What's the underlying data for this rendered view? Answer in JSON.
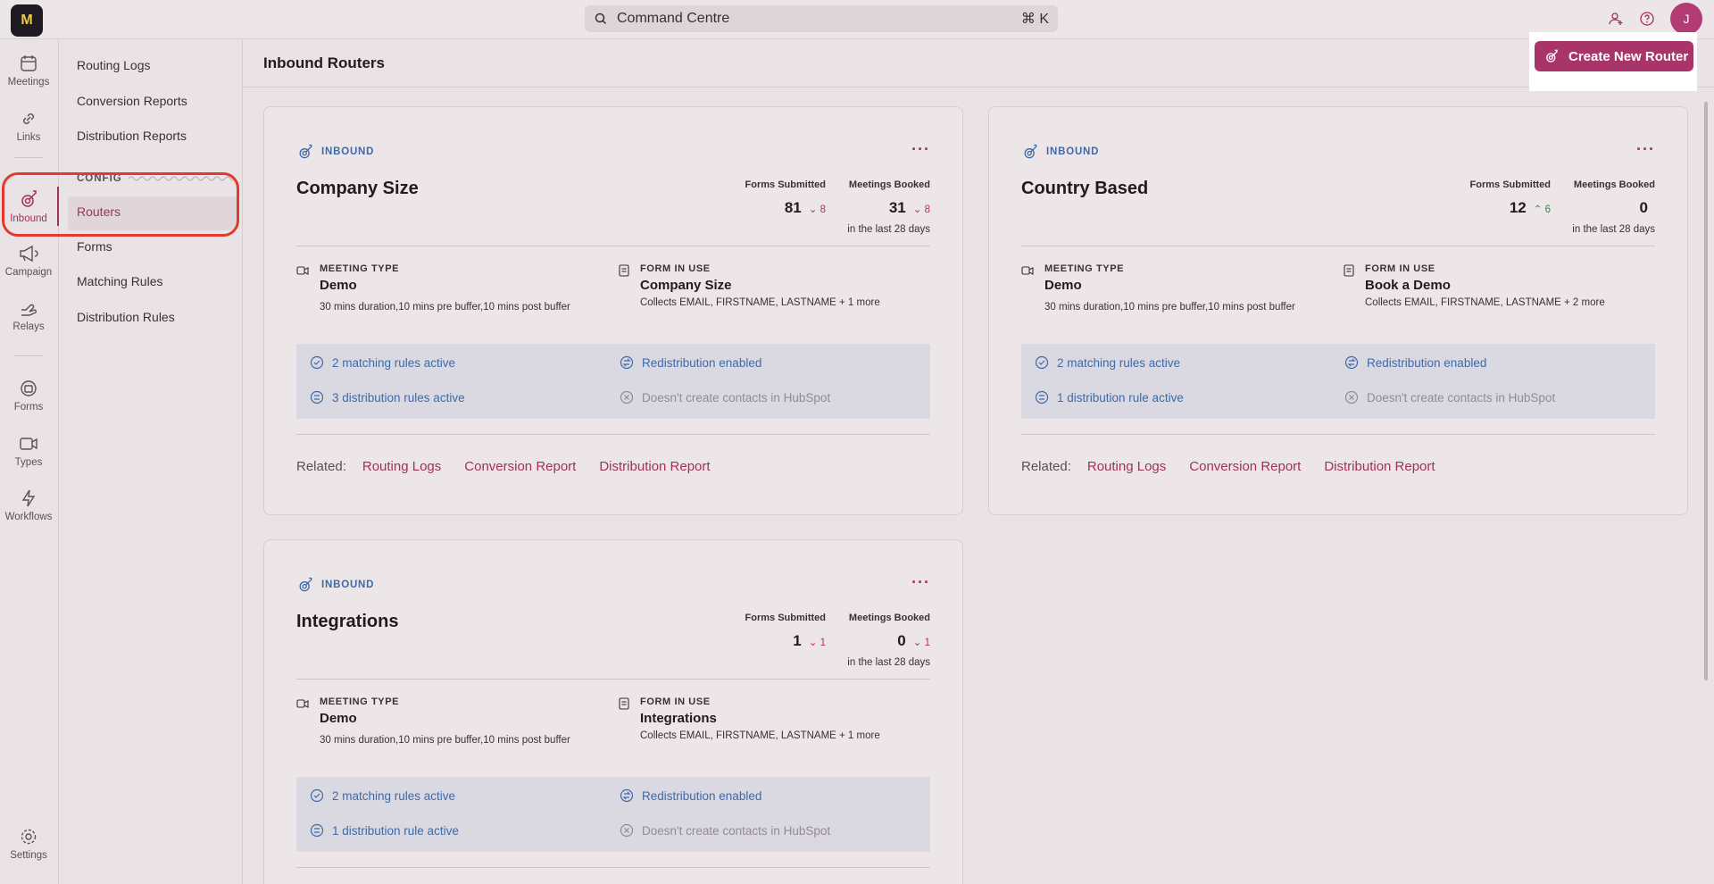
{
  "topbar": {
    "logo_text": "M",
    "search_label": "Command Centre",
    "search_shortcut": "⌘ K",
    "avatar_initial": "J"
  },
  "rail": {
    "items": [
      {
        "label": "Meetings",
        "icon": "calendar-icon"
      },
      {
        "label": "Links",
        "icon": "link-icon"
      },
      {
        "label": "Inbound",
        "icon": "inbound-icon",
        "active": true
      },
      {
        "label": "Campaign",
        "icon": "megaphone-icon"
      },
      {
        "label": "Relays",
        "icon": "hand-icon"
      },
      {
        "label": "Forms",
        "icon": "form-icon"
      },
      {
        "label": "Types",
        "icon": "video-icon"
      },
      {
        "label": "Workflows",
        "icon": "lightning-icon"
      },
      {
        "label": "Settings",
        "icon": "gear-icon"
      }
    ]
  },
  "subnav": {
    "items": [
      "Routing Logs",
      "Conversion Reports",
      "Distribution Reports"
    ],
    "config_label": "CONFIG",
    "config_items": [
      "Routers",
      "Forms",
      "Matching Rules",
      "Distribution Rules"
    ]
  },
  "main": {
    "title": "Inbound Routers",
    "create_button": "Create New Router"
  },
  "labels": {
    "tag": "INBOUND",
    "forms_submitted": "Forms Submitted",
    "meetings_booked": "Meetings Booked",
    "period": "in the last 28 days",
    "meeting_type": "MEETING TYPE",
    "form_in_use": "FORM IN USE",
    "related": "Related:",
    "link_routing_logs": "Routing Logs",
    "link_conversion": "Conversion Report",
    "link_distribution": "Distribution Report",
    "more": "···"
  },
  "cards": [
    {
      "title": "Company Size",
      "forms_submitted": "81",
      "forms_delta": "8",
      "forms_dir": "down",
      "meetings_booked": "31",
      "meetings_delta": "8",
      "meetings_dir": "down",
      "meeting_type": "Demo",
      "meeting_desc": "30 mins duration,10 mins pre buffer,10 mins post buffer",
      "form_name": "Company Size",
      "form_desc": "Collects EMAIL, FIRSTNAME, LASTNAME + 1 more",
      "matching_rules": "2 matching rules active",
      "distribution_rules": "3 distribution rules active",
      "redistribution": "Redistribution enabled",
      "hubspot": "Doesn't create contacts in HubSpot"
    },
    {
      "title": "Country Based",
      "forms_submitted": "12",
      "forms_delta": "6",
      "forms_dir": "up",
      "meetings_booked": "0",
      "meetings_delta": "",
      "meetings_dir": "",
      "meeting_type": "Demo",
      "meeting_desc": "30 mins duration,10 mins pre buffer,10 mins post buffer",
      "form_name": "Book a Demo",
      "form_desc": "Collects EMAIL, FIRSTNAME, LASTNAME + 2 more",
      "matching_rules": "2 matching rules active",
      "distribution_rules": "1 distribution rule active",
      "redistribution": "Redistribution enabled",
      "hubspot": "Doesn't create contacts in HubSpot"
    },
    {
      "title": "Integrations",
      "forms_submitted": "1",
      "forms_delta": "1",
      "forms_dir": "down",
      "meetings_booked": "0",
      "meetings_delta": "1",
      "meetings_dir": "down",
      "meeting_type": "Demo",
      "meeting_desc": "30 mins duration,10 mins pre buffer,10 mins post buffer",
      "form_name": "Integrations",
      "form_desc": "Collects EMAIL, FIRSTNAME, LASTNAME + 1 more",
      "matching_rules": "2 matching rules active",
      "distribution_rules": "1 distribution rule active",
      "redistribution": "Redistribution enabled",
      "hubspot": "Doesn't create contacts in HubSpot"
    }
  ],
  "colors": {
    "accent": "#a9346a",
    "link_blue": "#3d6aa8",
    "delta_down": "#b2344a",
    "delta_up": "#2f8a4a",
    "highlight_ring": "#e23b2e"
  }
}
